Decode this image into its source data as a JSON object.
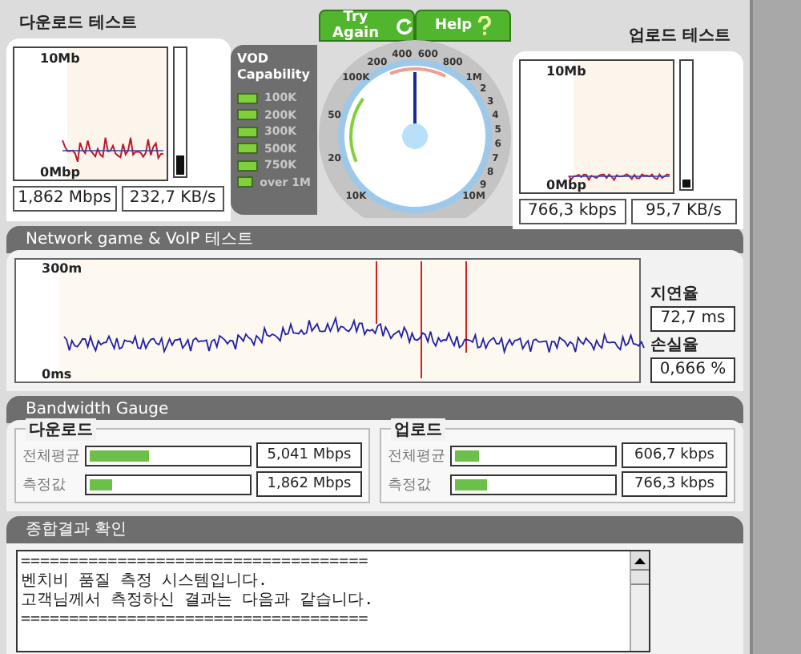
{
  "download_test": {
    "title": "다운로드 테스트",
    "top_label": "10Mb",
    "bottom_label": "0Mbp",
    "meter": {
      "level": 0.16
    },
    "speed": "1,862 Mbps",
    "rate": "232,7 KB/s"
  },
  "vod": {
    "title": "VOD Capability",
    "levels": [
      "100K",
      "200K",
      "300K",
      "500K",
      "750K",
      "over 1M"
    ]
  },
  "buttons": [
    {
      "label": "Try Again",
      "kind": "refresh"
    },
    {
      "label": "Help",
      "kind": "help"
    }
  ],
  "dial": {
    "labels": [
      "10K",
      "20",
      "50",
      "100K",
      "200",
      "400",
      "600",
      "800",
      "1M",
      "2",
      "3",
      "4",
      "5",
      "6",
      "7",
      "8",
      "9",
      "10M"
    ],
    "level": 0.5
  },
  "upload_test": {
    "title": "업로드 테스트",
    "top_label": "10Mb",
    "bottom_label": "0Mbp",
    "meter": {
      "level": 0.07
    },
    "speed": "766,3 kbps",
    "rate": "95,7 KB/s"
  },
  "network_test": {
    "title": "Network game & VoIP 테스트",
    "top_label": "300m",
    "bottom_label": "0ms",
    "latency_label": "지연율",
    "latency": "72,7 ms",
    "loss_label": "손실율",
    "loss": "0,666 %"
  },
  "bandwidth": {
    "title": "Bandwidth Gauge",
    "groups": [
      {
        "title": "다운로드",
        "rows": [
          {
            "label": "전체평균",
            "level": 0.38,
            "value": "5,041 Mbps"
          },
          {
            "label": "측정값",
            "level": 0.14,
            "value": "1,862 Mbps"
          }
        ]
      },
      {
        "title": "업로드",
        "rows": [
          {
            "label": "전체평균",
            "level": 0.15,
            "value": "606,7 kbps"
          },
          {
            "label": "측정값",
            "level": 0.2,
            "value": "766,3 kbps"
          }
        ]
      }
    ]
  },
  "summary": {
    "title": "종합결과 확인",
    "lines": [
      "====================================",
      "벤치비 품질 측정 시스템입니다.",
      "고객님께서 측정하신 결과는 다음과 같습니다.",
      "===================================="
    ]
  }
}
